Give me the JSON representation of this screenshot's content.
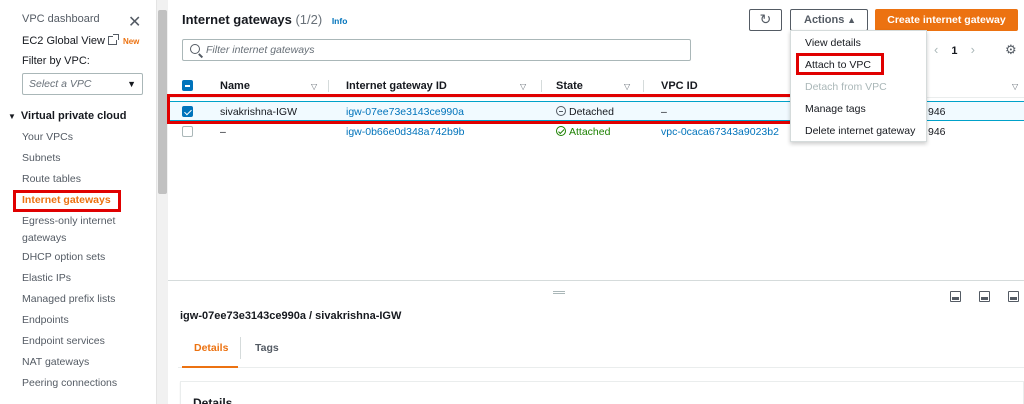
{
  "sidebar": {
    "dashboard": "VPC dashboard",
    "global_view": "EC2 Global View",
    "new_badge": "New",
    "filter_label": "Filter by VPC:",
    "filter_placeholder": "Select a VPC",
    "section": "Virtual private cloud",
    "items": [
      "Your VPCs",
      "Subnets",
      "Route tables",
      "Internet gateways",
      "Egress-only internet gateways",
      "DHCP option sets",
      "Elastic IPs",
      "Managed prefix lists",
      "Endpoints",
      "Endpoint services",
      "NAT gateways",
      "Peering connections"
    ]
  },
  "header": {
    "title": "Internet gateways",
    "count": "(1/2)",
    "info": "Info",
    "actions": "Actions",
    "create": "Create internet gateway"
  },
  "search": {
    "placeholder": "Filter internet gateways"
  },
  "pager": {
    "page": "1"
  },
  "table": {
    "columns": [
      "Name",
      "Internet gateway ID",
      "State",
      "VPC ID"
    ],
    "rows": [
      {
        "name": "sivakrishna-IGW",
        "id": "igw-07ee73e3143ce990a",
        "state": "Detached",
        "vpc": "–",
        "extra": "946",
        "selected": true
      },
      {
        "name": "–",
        "id": "igw-0b66e0d348a742b9b",
        "state": "Attached",
        "vpc": "vpc-0caca67343a9023b2",
        "extra": "946",
        "selected": false
      }
    ]
  },
  "actions_menu": [
    "View details",
    "Attach to VPC",
    "Detach from VPC",
    "Manage tags",
    "Delete internet gateway"
  ],
  "detail_panel": {
    "title": "igw-07ee73e3143ce990a / sivakrishna-IGW",
    "tabs": [
      "Details",
      "Tags"
    ],
    "card_title": "Details"
  },
  "colors": {
    "accent": "#ec7211",
    "link": "#0073bb",
    "highlight": "#e00000",
    "success": "#1d8102"
  }
}
